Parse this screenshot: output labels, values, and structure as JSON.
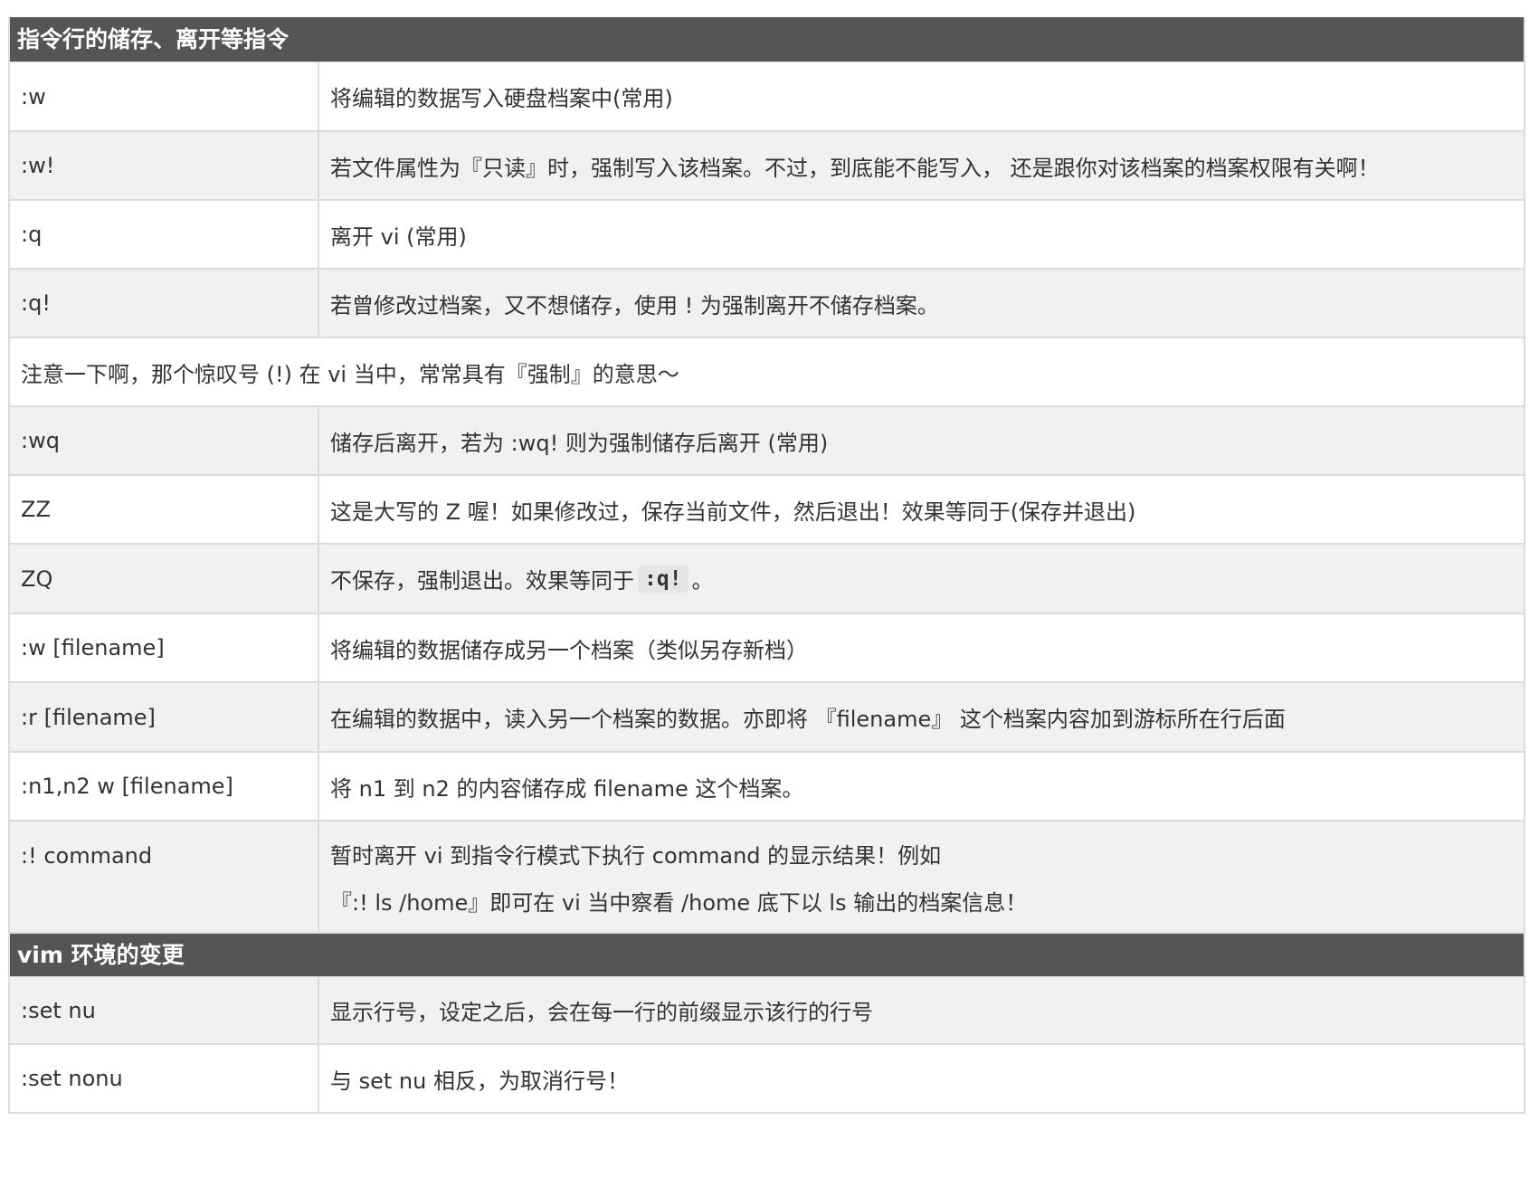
{
  "sections": [
    {
      "title": "指令行的储存、离开等指令",
      "rows": [
        {
          "cmd": ":w",
          "desc": "将编辑的数据写入硬盘档案中(常用)"
        },
        {
          "cmd": ":w!",
          "desc": "若文件属性为『只读』时，强制写入该档案。不过，到底能不能写入， 还是跟你对该档案的档案权限有关啊！"
        },
        {
          "cmd": ":q",
          "desc": "离开 vi (常用)"
        },
        {
          "cmd": ":q!",
          "desc": "若曾修改过档案，又不想储存，使用 ! 为强制离开不储存档案。"
        }
      ],
      "note": "注意一下啊，那个惊叹号 (!) 在 vi 当中，常常具有『强制』的意思～",
      "rows2": [
        {
          "cmd": ":wq",
          "desc": "储存后离开，若为 :wq! 则为强制储存后离开 (常用)"
        },
        {
          "cmd": "ZZ",
          "desc": "这是大写的 Z 喔！如果修改过，保存当前文件，然后退出！效果等同于(保存并退出)"
        },
        {
          "cmd": "ZQ",
          "desc_before": "不保存，强制退出。效果等同于",
          "desc_code": ":q!",
          "desc_after": "。"
        },
        {
          "cmd": ":w [filename]",
          "desc": "将编辑的数据储存成另一个档案（类似另存新档）"
        },
        {
          "cmd": ":r [filename]",
          "desc": "在编辑的数据中，读入另一个档案的数据。亦即将 『filename』 这个档案内容加到游标所在行后面"
        },
        {
          "cmd": ":n1,n2 w [filename]",
          "desc": "将 n1 到 n2 的内容储存成 filename 这个档案。"
        },
        {
          "cmd": ":! command",
          "desc_line1": "暂时离开 vi 到指令行模式下执行 command 的显示结果！例如",
          "desc_line2": "『:! ls /home』即可在 vi 当中察看 /home 底下以 ls 输出的档案信息！"
        }
      ]
    },
    {
      "title": "vim 环境的变更",
      "rows": [
        {
          "cmd": ":set nu",
          "desc": "显示行号，设定之后，会在每一行的前缀显示该行的行号"
        },
        {
          "cmd": ":set nonu",
          "desc": "与 set nu 相反，为取消行号！"
        }
      ]
    }
  ]
}
